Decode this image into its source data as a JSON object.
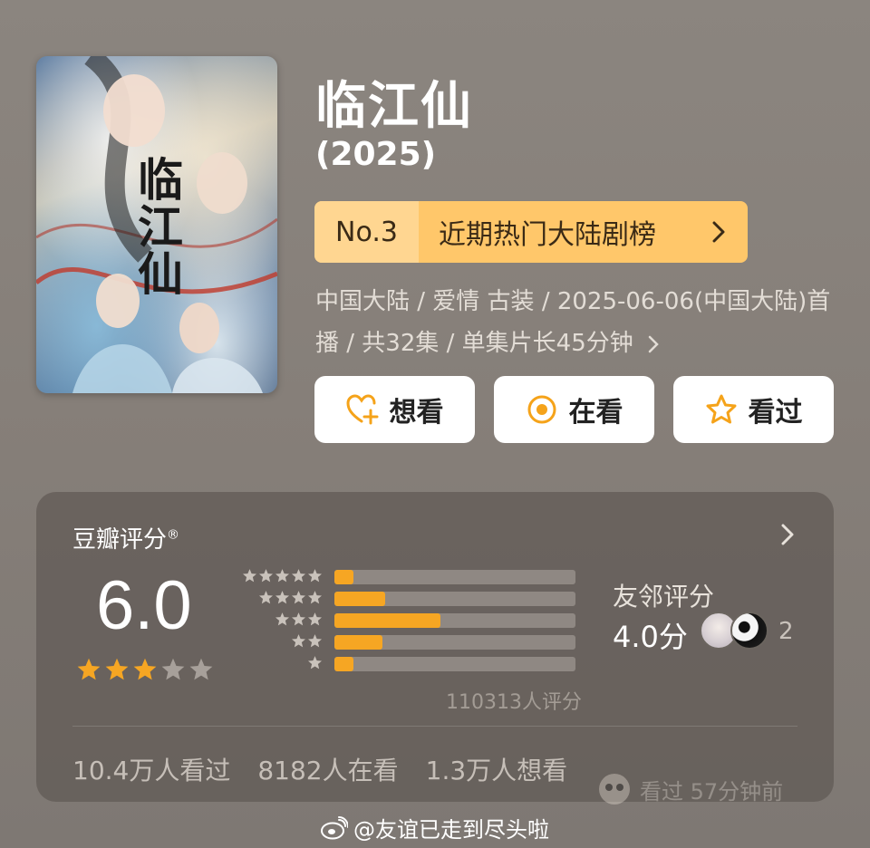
{
  "poster": {
    "title": "临江仙"
  },
  "header": {
    "title": "临江仙",
    "year": "(2025)"
  },
  "rank": {
    "number": "No.3",
    "list_name": "近期热门大陆剧榜"
  },
  "meta": {
    "text": "中国大陆 / 爱情 古装 / 2025-06-06(中国大陆)首播 / 共32集 / 单集片长45分钟"
  },
  "actions": [
    {
      "label": "想看",
      "icon": "heart-plus-icon"
    },
    {
      "label": "在看",
      "icon": "target-icon"
    },
    {
      "label": "看过",
      "icon": "star-outline-icon"
    }
  ],
  "rating": {
    "title": "豆瓣评分",
    "mark": "®",
    "score": "6.0",
    "stars": 3,
    "distribution": [
      {
        "stars": 5,
        "fraction": 0.08
      },
      {
        "stars": 4,
        "fraction": 0.21
      },
      {
        "stars": 3,
        "fraction": 0.44
      },
      {
        "stars": 2,
        "fraction": 0.2
      },
      {
        "stars": 1,
        "fraction": 0.08
      }
    ],
    "votes": "110313人评分",
    "friend_label": "友邻评分",
    "friend_score": "4.0分",
    "friend_count": "2",
    "stats": [
      "10.4万人看过",
      "8182人在看",
      "1.3万人想看"
    ],
    "watermark_text": "看过  57分钟前"
  },
  "footer": {
    "text": "@友谊已走到尽头啦"
  },
  "colors": {
    "accent": "#f6a623",
    "rank_bg": "#ffc76a",
    "rank_no_bg": "#ffd691"
  }
}
